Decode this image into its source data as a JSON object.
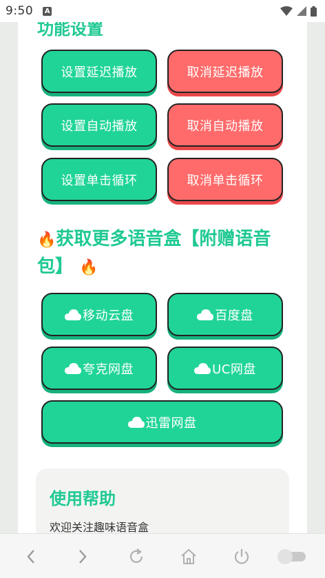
{
  "status_bar": {
    "time": "9:50",
    "notification_letter": "A"
  },
  "section_function": {
    "title": "功能设置"
  },
  "function_buttons": [
    {
      "label": "设置延迟播放",
      "color": "#20d497"
    },
    {
      "label": "取消延迟播放",
      "color": "#ff6b6b"
    },
    {
      "label": "设置自动播放",
      "color": "#20d497"
    },
    {
      "label": "取消自动播放",
      "color": "#ff6b6b"
    },
    {
      "label": "设置单击循环",
      "color": "#20d497"
    },
    {
      "label": "取消单击循环",
      "color": "#ff6b6b"
    }
  ],
  "section_more": {
    "title": "获取更多语音盒【附赠语音包】"
  },
  "cloud_buttons": [
    {
      "label": "移动云盘",
      "icon": "cloud-icon"
    },
    {
      "label": "百度盘",
      "icon": "cloud-icon"
    },
    {
      "label": "夸克网盘",
      "icon": "cloud-icon"
    },
    {
      "label": "UC网盘",
      "icon": "cloud-icon"
    },
    {
      "label": "迅雷网盘",
      "icon": "cloud-icon"
    }
  ],
  "help": {
    "title": "使用帮助",
    "text": "欢迎关注趣味语音盒"
  },
  "colors": {
    "accent": "#1fc993",
    "green_button": "#20d497",
    "red_button": "#ff6b6b"
  },
  "bottom_nav": [
    "back-icon",
    "forward-icon",
    "refresh-icon",
    "home-icon",
    "power-icon",
    "toggle-switch"
  ]
}
